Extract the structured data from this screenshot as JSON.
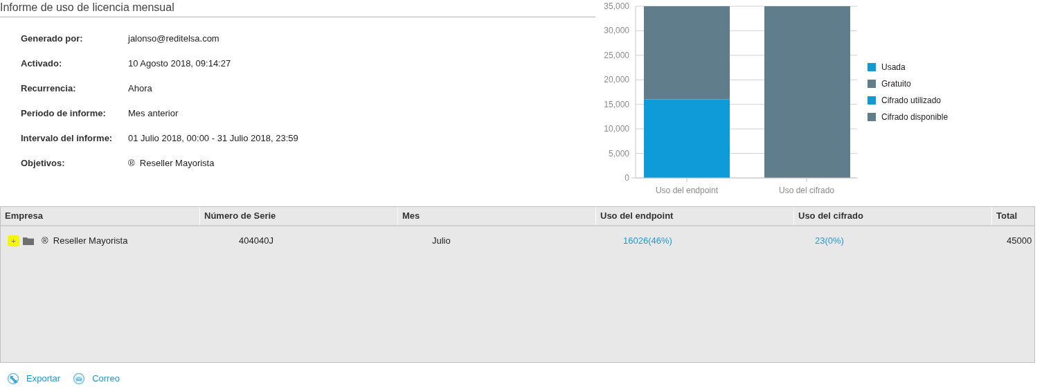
{
  "title": "Informe de uso de licencia mensual",
  "details": [
    {
      "label": "Generado por:",
      "value": "jalonso@reditelsa.com"
    },
    {
      "label": "Activado:",
      "value": "10 Agosto 2018, 09:14:27"
    },
    {
      "label": "Recurrencia:",
      "value": "Ahora"
    },
    {
      "label": "Periodo de informe:",
      "value": "Mes anterior"
    },
    {
      "label": "Intervalo del informe:",
      "value": "01 Julio 2018, 00:00 - 31 Julio 2018, 23:59"
    },
    {
      "label": "Objetivos:",
      "value": "®  Reseller Mayorista"
    }
  ],
  "chart_data": {
    "type": "bar",
    "stacked": true,
    "categories": [
      "Uso del endpoint",
      "Uso del cifrado"
    ],
    "ylim": [
      0,
      35000
    ],
    "yticks": [
      {
        "value": 0,
        "label": "0"
      },
      {
        "value": 5000,
        "label": "5,000"
      },
      {
        "value": 10000,
        "label": "10,000"
      },
      {
        "value": 15000,
        "label": "15,000"
      },
      {
        "value": 20000,
        "label": "20,000"
      },
      {
        "value": 25000,
        "label": "25,000"
      },
      {
        "value": 30000,
        "label": "30,000"
      },
      {
        "value": 35000,
        "label": "35,000"
      }
    ],
    "grid": true,
    "legend": "right",
    "series": [
      {
        "name": "Usada",
        "color": "#0f9bd7",
        "values": [
          16000,
          null
        ]
      },
      {
        "name": "Gratuito",
        "color": "#607d8b",
        "values": [
          19000,
          null
        ]
      },
      {
        "name": "Cifrado utilizado",
        "color": "#0f9bd7",
        "values": [
          null,
          0
        ]
      },
      {
        "name": "Cifrado disponible",
        "color": "#607d8b",
        "values": [
          null,
          35000
        ]
      }
    ]
  },
  "table": {
    "columns": [
      "Empresa",
      "Número de Serie",
      "Mes",
      "Uso del endpoint",
      "Uso del cifrado",
      "Total"
    ],
    "rows": [
      {
        "toggle": "+",
        "company": "®  Reseller Mayorista",
        "serial": "404040J",
        "month": "Julio",
        "endpoint": "16026(46%)",
        "encryption": "23(0%)",
        "total": "45000"
      }
    ]
  },
  "actions": [
    {
      "kind": "export",
      "label": "Exportar"
    },
    {
      "kind": "mail",
      "label": "Correo"
    }
  ]
}
